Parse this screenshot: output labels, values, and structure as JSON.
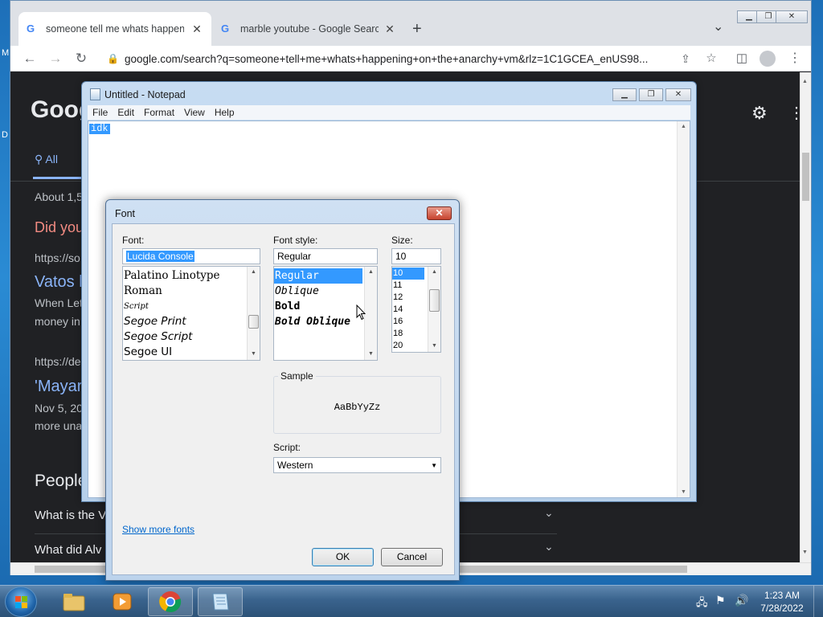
{
  "desktop": {
    "letter_m": "M",
    "letter_d": "D"
  },
  "chrome": {
    "tabs": [
      {
        "title": "someone tell me whats happening on the anarchy vm",
        "favicon": "G",
        "active": true
      },
      {
        "title": "marble youtube - Google Search",
        "favicon": "G",
        "active": false
      }
    ],
    "new_tab": "+",
    "tab_search": "⌄",
    "window_controls": {
      "minimize": "▁",
      "restore": "❐",
      "close": "✕"
    },
    "address": "google.com/search?q=someone+tell+me+whats+happening+on+the+anarchy+vm&rlz=1C1GCEA_enUS98...",
    "nav": {
      "back": "←",
      "forward": "→",
      "reload": "↻"
    },
    "page": {
      "logo": "Goog",
      "tab_all": "All",
      "about": "About 1,5",
      "did_you": "Did you",
      "url1": "https://so",
      "link1": "Vatos l",
      "snippet1a": "When Let",
      "snippet1b": "money in",
      "url2": "https://de",
      "link2": "'Mayar",
      "date2": "Nov 5, 20",
      "snippet2": "more una",
      "people": "People",
      "q1": "What is the V",
      "q2": "What did Alv"
    }
  },
  "notepad": {
    "title": "Untitled - Notepad",
    "menu": [
      "File",
      "Edit",
      "Format",
      "View",
      "Help"
    ],
    "text": "idk",
    "controls": {
      "minimize": "▁",
      "restore": "❐",
      "close": "✕"
    }
  },
  "font_dialog": {
    "title": "Font",
    "close": "✕",
    "font_label": "Font:",
    "font_value": "Lucida Console",
    "fonts": [
      "Palatino Linotype",
      "Roman",
      "Script",
      "Segoe Print",
      "Segoe Script",
      "Segoe UI"
    ],
    "style_label": "Font style:",
    "style_value": "Regular",
    "styles": [
      "Regular",
      "Oblique",
      "Bold",
      "Bold Oblique"
    ],
    "size_label": "Size:",
    "size_value": "10",
    "sizes": [
      "10",
      "11",
      "12",
      "14",
      "16",
      "18",
      "20"
    ],
    "sample_label": "Sample",
    "sample_text": "AaBbYyZz",
    "script_label": "Script:",
    "script_value": "Western",
    "show_more": "Show more fonts",
    "ok": "OK",
    "cancel": "Cancel"
  },
  "taskbar": {
    "time": "1:23 AM",
    "date": "7/28/2022"
  }
}
